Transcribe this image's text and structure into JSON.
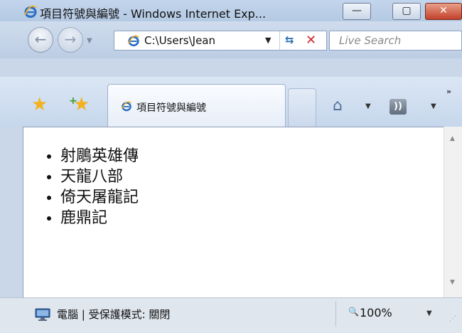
{
  "window": {
    "title": "項目符號與編號 - Windows Internet Exp...",
    "minimize_glyph": "—",
    "maximize_glyph": "▢",
    "close_glyph": "✕"
  },
  "navbar": {
    "back_glyph": "←",
    "forward_glyph": "→",
    "history_glyph": "▼",
    "address": "C:\\Users\\Jean",
    "address_dropdown_glyph": "▼",
    "refresh_glyph": "⇆",
    "stop_glyph": "✕",
    "search_placeholder": "Live Search"
  },
  "tabbar": {
    "favorites_glyph": "★",
    "add_favorite_glyph": "★",
    "add_plus_glyph": "+",
    "tab_label": "項目符號與編號",
    "home_glyph": "⌂",
    "home_drop_glyph": "▼",
    "feeds_glyph": "))",
    "feeds_drop_glyph": "▼",
    "more_glyph": "»"
  },
  "content": {
    "items": [
      "射鵰英雄傳",
      "天龍八部",
      "倚天屠龍記",
      "鹿鼎記"
    ]
  },
  "scrollbar": {
    "up_glyph": "▲",
    "down_glyph": "▼"
  },
  "statusbar": {
    "zone_text": "電腦 | 受保護模式: 關閉",
    "zoom_icon_glyph": "🔍",
    "zoom_text": "100%",
    "zoom_drop_glyph": "▼",
    "grip_glyph": "⋰"
  },
  "colors": {
    "ie_blue": "#2a6dc4",
    "close_red": "#c2412b",
    "favorites_gold": "#f2b21d"
  }
}
